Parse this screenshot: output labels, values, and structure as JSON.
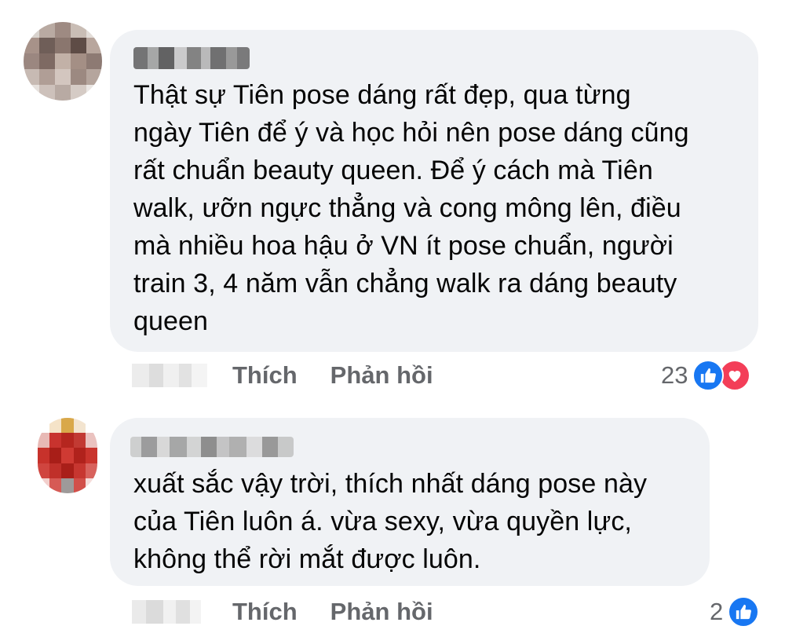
{
  "comments": [
    {
      "text": "Thật sự Tiên pose dáng rất đẹp, qua từng\nngày Tiên để ý và học hỏi nên pose dáng cũng\nrất chuẩn beauty queen. Để ý cách mà Tiên\nwalk, ưỡn ngực thẳng và cong mông lên, điều\nmà nhiều hoa hậu ở VN ít pose chuẩn, người\ntrain 3, 4 năm vẫn chẳng walk ra dáng beauty\nqueen",
      "like_label": "Thích",
      "reply_label": "Phản hồi",
      "reaction_count": "23",
      "reaction_icons": [
        "like-icon",
        "love-icon"
      ]
    },
    {
      "text": "xuất sắc vậy trời, thích nhất dáng pose này\ncủa Tiên luôn á. vừa sexy, vừa quyền lực,\nkhông thể rời mắt được luôn.",
      "like_label": "Thích",
      "reply_label": "Phản hồi",
      "reaction_count": "2",
      "reaction_icons": [
        "like-icon"
      ]
    }
  ],
  "colors": {
    "bubble": "#f0f2f5",
    "text": "#050505",
    "secondary": "#65676b",
    "like": "#1877f2",
    "love": "#f33e58"
  }
}
